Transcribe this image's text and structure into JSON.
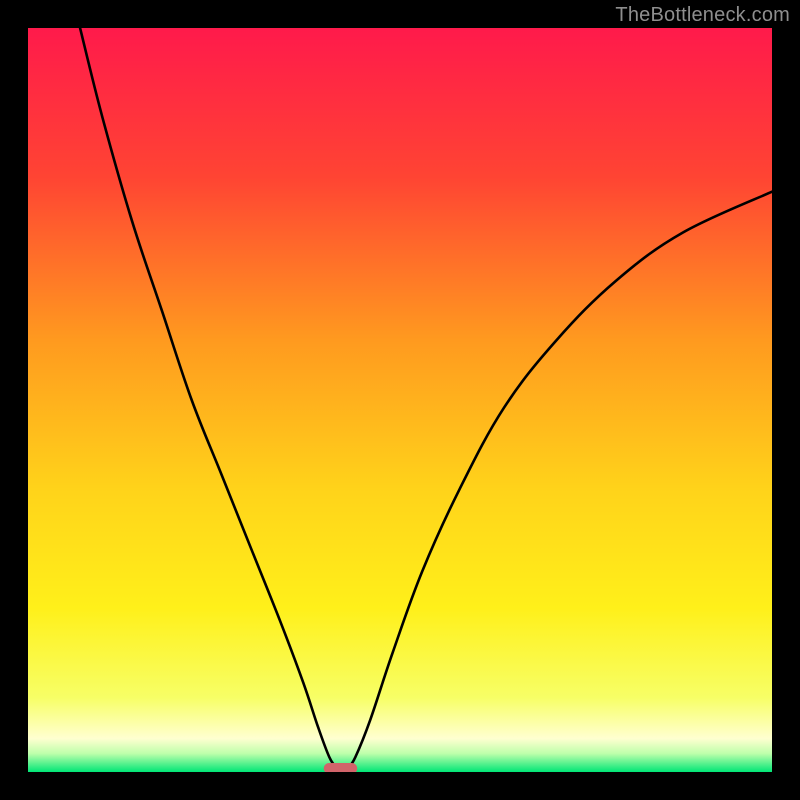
{
  "watermark": "TheBottleneck.com",
  "chart_data": {
    "type": "line",
    "title": "",
    "xlabel": "",
    "ylabel": "",
    "xlim": [
      0,
      100
    ],
    "ylim": [
      0,
      100
    ],
    "grid": false,
    "gradient_stops": [
      {
        "offset": 0.0,
        "color": "#ff1a4b"
      },
      {
        "offset": 0.2,
        "color": "#ff4433"
      },
      {
        "offset": 0.42,
        "color": "#ff9a1f"
      },
      {
        "offset": 0.62,
        "color": "#ffd31a"
      },
      {
        "offset": 0.78,
        "color": "#fff01a"
      },
      {
        "offset": 0.9,
        "color": "#f7ff66"
      },
      {
        "offset": 0.955,
        "color": "#ffffd0"
      },
      {
        "offset": 0.975,
        "color": "#bfffab"
      },
      {
        "offset": 1.0,
        "color": "#00e676"
      }
    ],
    "minimum_marker": {
      "x": 42,
      "y": 0,
      "width": 4.5,
      "color": "#d1646a"
    },
    "series": [
      {
        "name": "left_branch",
        "points": [
          {
            "x": 7.0,
            "y": 100.0
          },
          {
            "x": 10.0,
            "y": 88.0
          },
          {
            "x": 14.0,
            "y": 74.0
          },
          {
            "x": 18.0,
            "y": 62.0
          },
          {
            "x": 22.0,
            "y": 50.0
          },
          {
            "x": 26.0,
            "y": 40.0
          },
          {
            "x": 30.0,
            "y": 30.0
          },
          {
            "x": 34.0,
            "y": 20.0
          },
          {
            "x": 37.0,
            "y": 12.0
          },
          {
            "x": 39.0,
            "y": 6.0
          },
          {
            "x": 40.5,
            "y": 2.0
          },
          {
            "x": 41.5,
            "y": 0.5
          }
        ]
      },
      {
        "name": "right_branch",
        "points": [
          {
            "x": 43.0,
            "y": 0.5
          },
          {
            "x": 44.0,
            "y": 2.0
          },
          {
            "x": 46.0,
            "y": 7.0
          },
          {
            "x": 49.0,
            "y": 16.0
          },
          {
            "x": 53.0,
            "y": 27.0
          },
          {
            "x": 58.0,
            "y": 38.0
          },
          {
            "x": 64.0,
            "y": 49.0
          },
          {
            "x": 71.0,
            "y": 58.0
          },
          {
            "x": 79.0,
            "y": 66.0
          },
          {
            "x": 88.0,
            "y": 72.5
          },
          {
            "x": 100.0,
            "y": 78.0
          }
        ]
      }
    ]
  }
}
